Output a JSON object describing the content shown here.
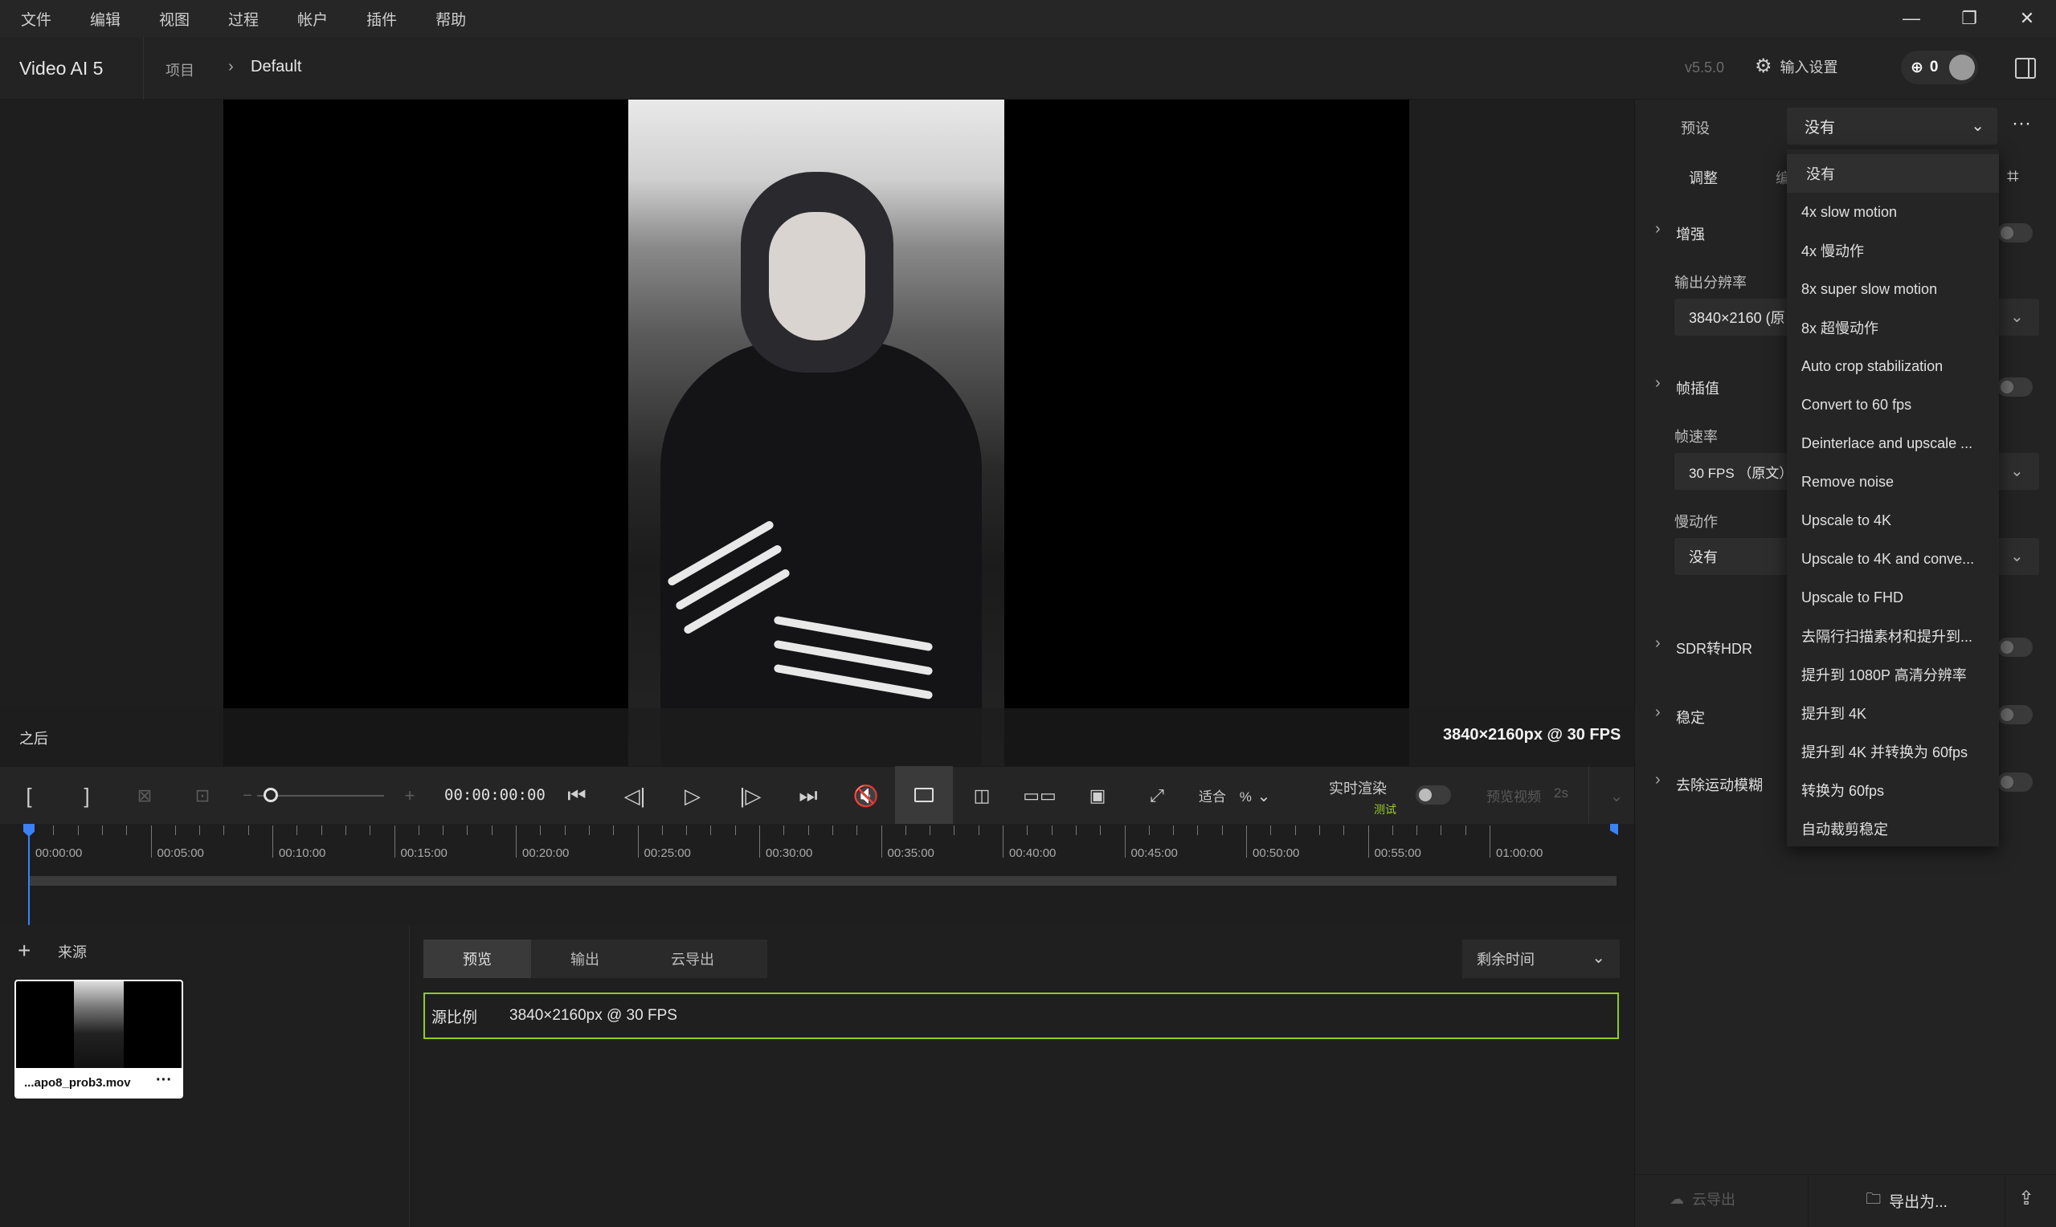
{
  "menu": [
    "文件",
    "编辑",
    "视图",
    "过程",
    "帐户",
    "插件",
    "帮助"
  ],
  "header": {
    "app_name": "Video AI  5",
    "crumb_project": "项目",
    "crumb_default": "Default",
    "version": "v5.5.0",
    "settings_label": "输入设置",
    "credits": "0"
  },
  "preview": {
    "after_label": "之后",
    "resolution": "3840×2160px @ 30 FPS"
  },
  "transport": {
    "timecode": "00:00:00:00",
    "fit_label": "适合",
    "fit_pct": "%",
    "realtime_label": "实时渲染",
    "beta_label": "测试",
    "preview_video_label": "预览视频",
    "preview_duration": "2s"
  },
  "timeline": {
    "labels": [
      "00:00:00",
      "00:05:00",
      "00:10:00",
      "00:15:00",
      "00:20:00",
      "00:25:00",
      "00:30:00",
      "00:35:00",
      "00:40:00",
      "00:45:00",
      "00:50:00",
      "00:55:00",
      "01:00:00"
    ]
  },
  "sources": {
    "label": "来源",
    "file_name": "...apo8_prob3.mov"
  },
  "output": {
    "tabs": [
      "预览",
      "输出",
      "云导出"
    ],
    "remaining_label": "剩余时间",
    "row_label": "源比例",
    "row_value": "3840×2160px @ 30 FPS"
  },
  "right_panel": {
    "preset_label": "预设",
    "preset_value": "没有",
    "adjust_label": "调整",
    "adjust_tab2_partial": "编",
    "enhance": "增强",
    "output_res_label": "输出分辨率",
    "output_res_value": "3840×2160 (原",
    "frame_interp": "帧插值",
    "frame_rate_label": "帧速率",
    "frame_rate_value": "30 FPS （原文）",
    "slow_motion_label": "慢动作",
    "slow_motion_value": "没有",
    "sdr_hdr": "SDR转HDR",
    "stabilize": "稳定",
    "motion_deblur": "去除运动模糊",
    "cloud_export": "云导出",
    "export_as": "导出为..."
  },
  "dropdown": [
    "没有",
    "4x slow motion",
    "4x 慢动作",
    "8x super slow motion",
    "8x 超慢动作",
    "Auto crop stabilization",
    "Convert to 60 fps",
    "Deinterlace and upscale ...",
    "Remove noise",
    "Upscale to 4K",
    "Upscale to 4K and conve...",
    "Upscale to FHD",
    "去隔行扫描素材和提升到...",
    "提升到 1080P 高清分辨率",
    "提升到 4K",
    "提升到 4K 并转换为 60fps",
    "转换为 60fps",
    "自动裁剪稳定"
  ],
  "colors": {
    "accent_green": "#8fcc1f",
    "playhead_blue": "#3b82f6"
  }
}
